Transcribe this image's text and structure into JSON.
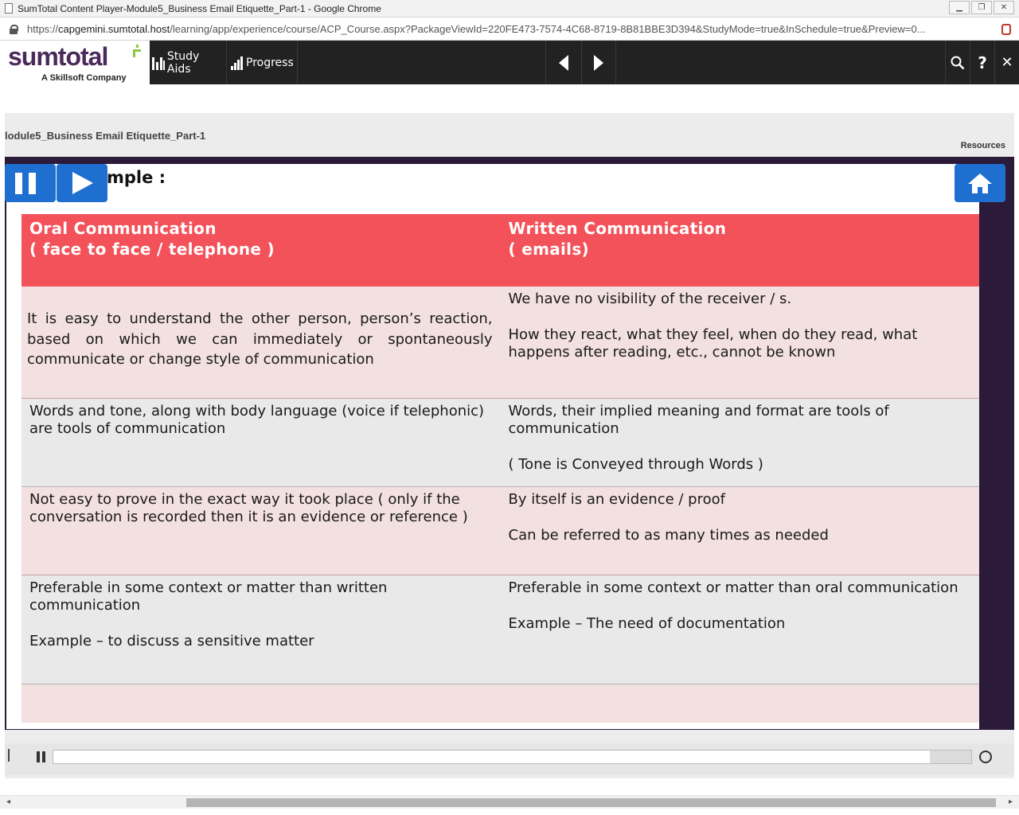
{
  "window": {
    "title": "SumTotal Content Player-Module5_Business Email Etiquette_Part-1 - Google Chrome",
    "min_glyph": "▁",
    "max_glyph": "❐",
    "close_glyph": "✕"
  },
  "address": {
    "scheme": "https://",
    "host": "capgemini.sumtotal.host",
    "path": "/learning/app/experience/course/ACP_Course.aspx?PackageViewId=220FE473-7574-4C68-8719-8B81BBE3D394&StudyMode=true&InSchedule=true&Preview=0..."
  },
  "header": {
    "logo_text": "sumtotal",
    "logo_sub": "A Skillsoft Company",
    "study_aids": "Study Aids",
    "progress": "Progress",
    "help_glyph": "?",
    "close_glyph": "✕"
  },
  "content": {
    "module_title": "lodule5_Business Email Etiquette_Part-1",
    "resources": "Resources",
    "heading_partial": "mple :"
  },
  "table": {
    "headers": {
      "left": [
        "Oral Communication",
        "( face to face / telephone )"
      ],
      "right": [
        "Written Communication",
        "( emails)"
      ]
    },
    "rows": [
      {
        "left": [
          "It is easy to understand the other person, person’s reaction, based on which we can immediately or spontaneously communicate or change style of communication"
        ],
        "right": [
          "We have no visibility of the receiver / s.",
          "How they react, what they feel, when do they read, what happens after reading, etc., cannot be known"
        ]
      },
      {
        "left": [
          "Words and tone, along with body language (voice if telephonic) are tools of communication"
        ],
        "right": [
          "Words, their implied meaning and format are tools of communication",
          "( Tone is Conveyed through Words )"
        ]
      },
      {
        "left": [
          "Not easy to prove in the exact way it took place  ( only if the conversation is recorded then it is an evidence or reference )"
        ],
        "right": [
          "By itself is an evidence / proof",
          "Can be referred to as many times as needed"
        ]
      },
      {
        "left": [
          "Preferable in some context or matter than written communication",
          "Example – to discuss a sensitive matter"
        ],
        "right": [
          "Preferable in some context or matter than oral communication",
          "Example – The need of documentation"
        ]
      }
    ]
  },
  "player": {
    "progress_fraction": 0.955
  },
  "colors": {
    "header_red": "#f4525a",
    "accent_blue": "#1e6fcf",
    "stage_purple": "#2b1a3a",
    "logo_purple": "#4a2a5a",
    "logo_green": "#8cc63f"
  },
  "icons": [
    "document-icon",
    "lock-icon",
    "search-icon",
    "help-icon",
    "close-icon",
    "pause-icon",
    "play-icon",
    "home-icon",
    "replay-icon",
    "study-aids-icon",
    "progress-icon",
    "prev-arrow-icon",
    "next-arrow-icon"
  ]
}
